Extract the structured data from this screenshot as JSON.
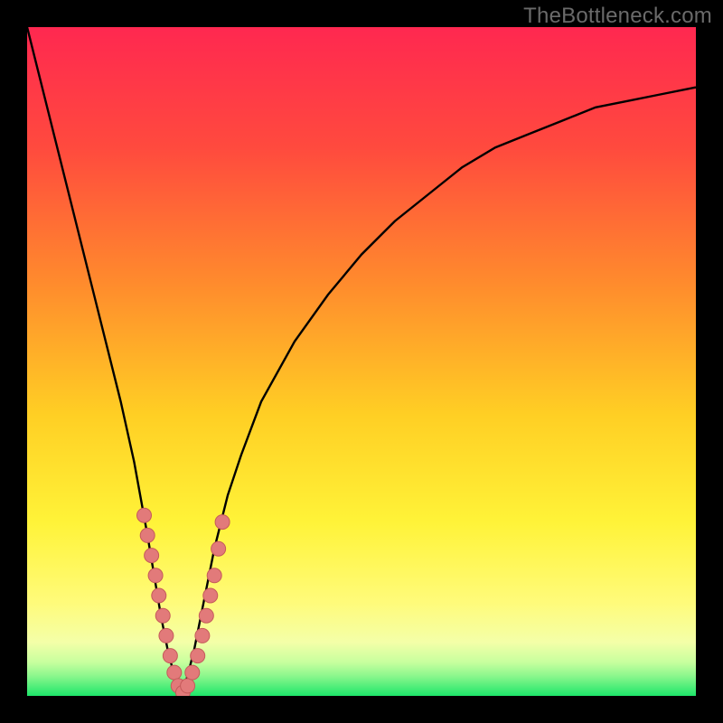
{
  "watermark": {
    "text": "TheBottleneck.com"
  },
  "colors": {
    "frame": "#000000",
    "curve": "#000000",
    "marker_fill": "#e27a7a",
    "marker_stroke": "#c55a5a",
    "gradient_stops": [
      {
        "offset": "0%",
        "color": "#ff2850"
      },
      {
        "offset": "18%",
        "color": "#ff4a3e"
      },
      {
        "offset": "38%",
        "color": "#ff8a2d"
      },
      {
        "offset": "58%",
        "color": "#ffcf24"
      },
      {
        "offset": "74%",
        "color": "#fff338"
      },
      {
        "offset": "86%",
        "color": "#fffb7a"
      },
      {
        "offset": "92%",
        "color": "#f4ffa8"
      },
      {
        "offset": "95%",
        "color": "#c7ff9e"
      },
      {
        "offset": "97%",
        "color": "#8cf78d"
      },
      {
        "offset": "100%",
        "color": "#1ee66a"
      }
    ]
  },
  "chart_data": {
    "type": "line",
    "title": "",
    "xlabel": "",
    "ylabel": "",
    "xlim": [
      0,
      100
    ],
    "ylim": [
      0,
      100
    ],
    "notes": "V-shaped bottleneck metric. y≈0 at the minimum near x≈23; rises toward 100 on both sides. Background hue encodes y (red high → green low).",
    "series": [
      {
        "name": "bottleneck_curve",
        "x": [
          0,
          2,
          4,
          6,
          8,
          10,
          12,
          14,
          16,
          18,
          19,
          20,
          21,
          22,
          23,
          24,
          25,
          26,
          27,
          28,
          29,
          30,
          32,
          35,
          40,
          45,
          50,
          55,
          60,
          65,
          70,
          75,
          80,
          85,
          90,
          95,
          100
        ],
        "values": [
          100,
          92,
          84,
          76,
          68,
          60,
          52,
          44,
          35,
          24,
          18,
          12,
          7,
          3,
          0,
          3,
          7,
          12,
          17,
          22,
          26,
          30,
          36,
          44,
          53,
          60,
          66,
          71,
          75,
          79,
          82,
          84,
          86,
          88,
          89,
          90,
          91
        ]
      },
      {
        "name": "marker_cluster",
        "type": "scatter",
        "x": [
          17.5,
          18.0,
          18.6,
          19.2,
          19.7,
          20.3,
          20.8,
          21.4,
          22.0,
          22.6,
          23.3,
          24.0,
          24.7,
          25.5,
          26.2,
          26.8,
          27.4,
          28.0,
          28.6,
          29.2
        ],
        "values": [
          27,
          24,
          21,
          18,
          15,
          12,
          9,
          6,
          3.5,
          1.5,
          0.5,
          1.5,
          3.5,
          6,
          9,
          12,
          15,
          18,
          22,
          26
        ]
      }
    ]
  }
}
